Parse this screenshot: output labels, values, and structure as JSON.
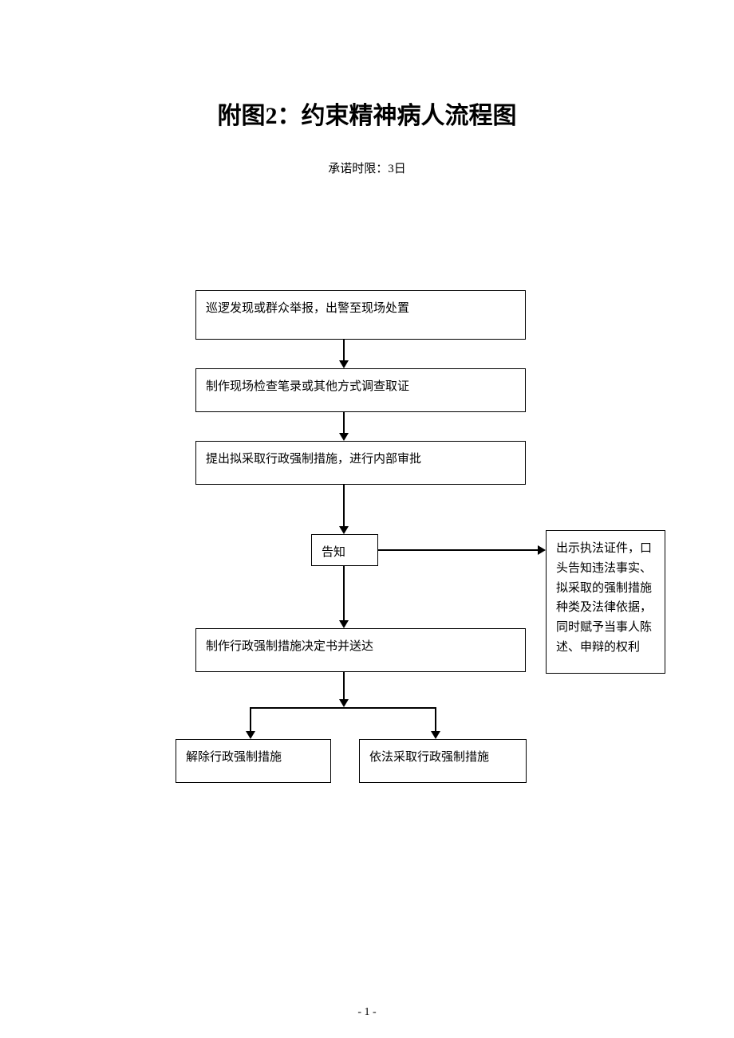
{
  "title": "附图2：约束精神病人流程图",
  "subtitle": "承诺时限：3日",
  "boxes": {
    "b1": "巡逻发现或群众举报，出警至现场处置",
    "b2": "制作现场检查笔录或其他方式调查取证",
    "b3": "提出拟采取行政强制措施，进行内部审批",
    "b4": "告知",
    "b5": "制作行政强制措施决定书并送达",
    "b6": "解除行政强制措施",
    "b7": "依法采取行政强制措施",
    "side": "出示执法证件，口头告知违法事实、拟采取的强制措施种类及法律依据，同时赋予当事人陈述、申辩的权利"
  },
  "page": "- 1 -"
}
